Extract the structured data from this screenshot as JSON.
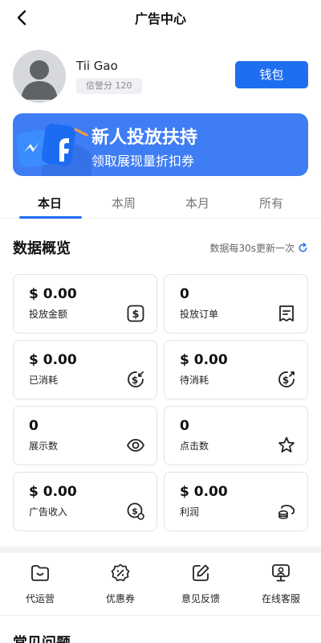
{
  "header": {
    "title": "广告中心",
    "back_icon": "chevron-left-icon"
  },
  "profile": {
    "username": "Tii Gao",
    "credit_label": "信誉分 120",
    "wallet_button": "钱包"
  },
  "banner": {
    "title": "新人投放扶持",
    "subtitle": "领取展现量折扣券",
    "art_icon": "messenger-facebook-icon"
  },
  "tabs": [
    {
      "label": "本日",
      "active": true
    },
    {
      "label": "本周",
      "active": false
    },
    {
      "label": "本月",
      "active": false
    },
    {
      "label": "所有",
      "active": false
    }
  ],
  "overview": {
    "title": "数据概览",
    "refresh_note": "数据每30s更新一次",
    "refresh_icon": "refresh-icon"
  },
  "stats": [
    {
      "value": "$ 0.00",
      "label": "投放金额",
      "icon": "dollar-box-icon"
    },
    {
      "value": "0",
      "label": "投放订单",
      "icon": "order-receipt-icon"
    },
    {
      "value": "$ 0.00",
      "label": "已消耗",
      "icon": "dollar-consumed-icon"
    },
    {
      "value": "$ 0.00",
      "label": "待消耗",
      "icon": "dollar-pending-icon"
    },
    {
      "value": "0",
      "label": "展示数",
      "icon": "eye-icon"
    },
    {
      "value": "0",
      "label": "点击数",
      "icon": "star-click-icon"
    },
    {
      "value": "$ 0.00",
      "label": "广告收入",
      "icon": "coin-income-icon"
    },
    {
      "value": "$ 0.00",
      "label": "利润",
      "icon": "coin-stack-icon"
    }
  ],
  "shortcuts": [
    {
      "label": "代运营",
      "icon": "folder-smile-icon"
    },
    {
      "label": "优惠券",
      "icon": "coupon-badge-icon"
    },
    {
      "label": "意见反馈",
      "icon": "edit-pencil-icon"
    },
    {
      "label": "在线客服",
      "icon": "support-agent-icon"
    }
  ],
  "faq": {
    "title": "常见问题"
  },
  "colors": {
    "accent": "#1f6ef0",
    "banner": "#3f7df5"
  }
}
